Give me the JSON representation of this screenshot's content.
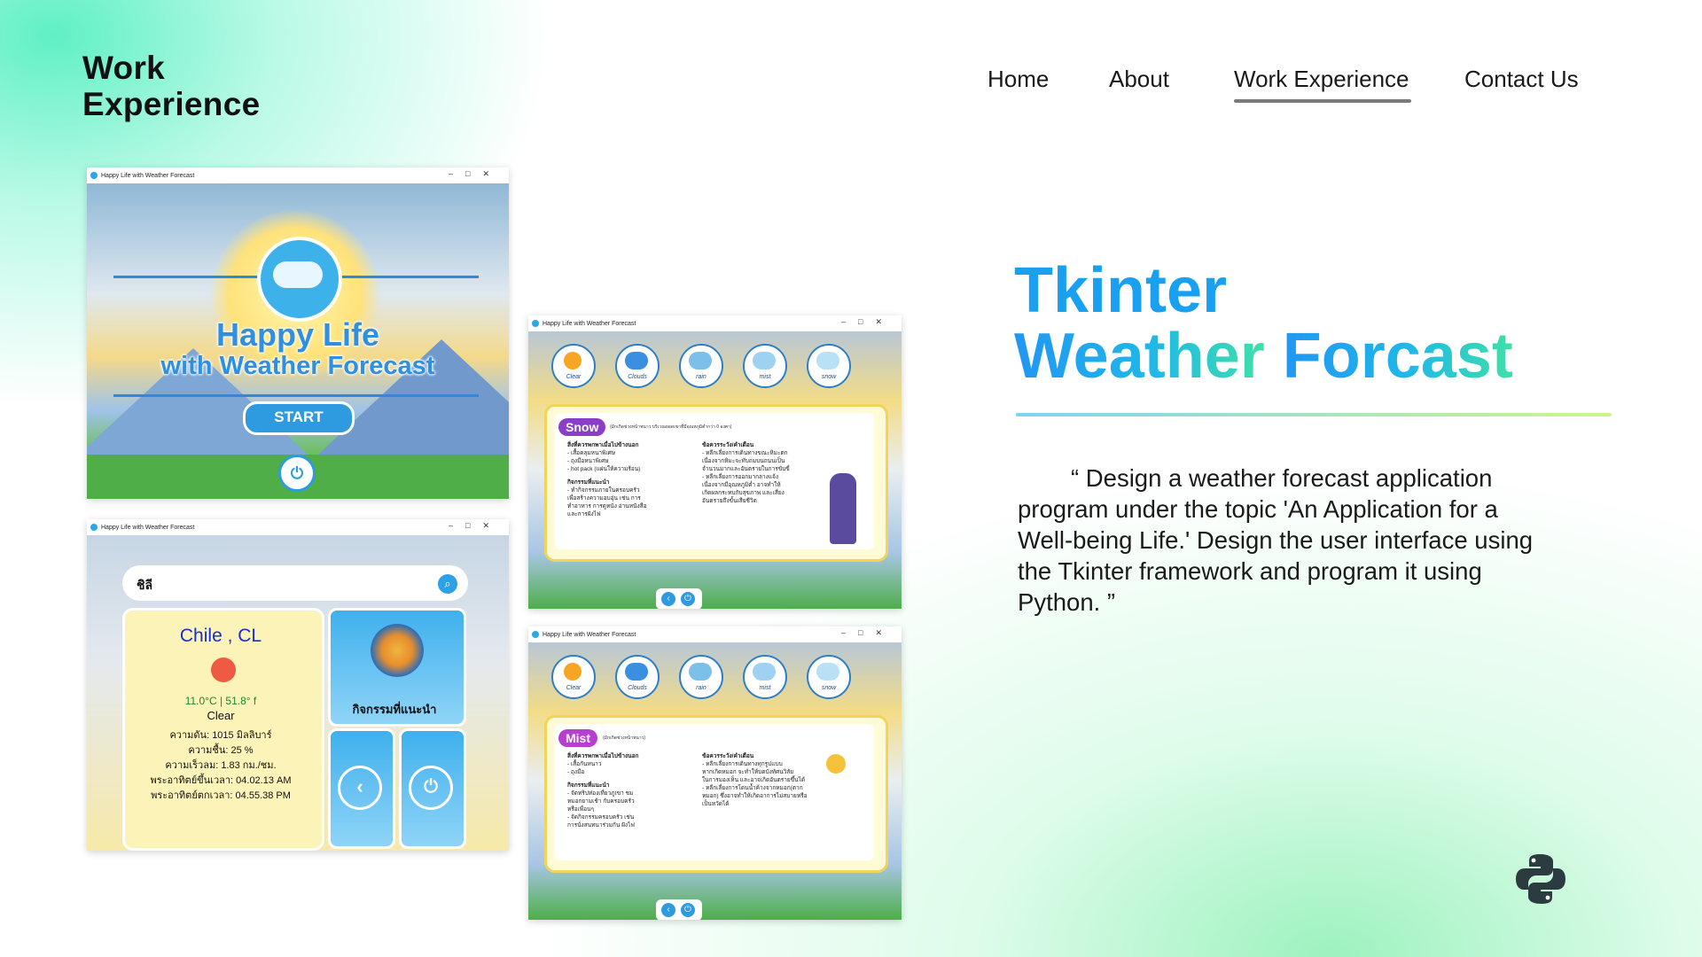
{
  "header": {
    "page_title_line1": "Work",
    "page_title_line2": "Experience",
    "nav": [
      {
        "label": "Home"
      },
      {
        "label": "About"
      },
      {
        "label": "Work Experience",
        "active": true
      },
      {
        "label": "Contact Us"
      }
    ]
  },
  "window_title": "Happy Life with Weather Forecast",
  "screen_start": {
    "title_line1": "Happy Life",
    "title_line2": "with Weather Forecast",
    "start_button": "START"
  },
  "screen_weather": {
    "search_value": "ชิลี",
    "city": "Chile , CL",
    "temperature": "11.0°C | 51.8° f",
    "condition": "Clear",
    "pressure": "ความดัน: 1015  มิลลิบาร์",
    "humidity": "ความชื้น: 25 %",
    "wind": "ความเร็วลม: 1.83  กม./ชม.",
    "sunrise": "พระอาทิตย์ขึ้นเวลา: 04.02.13 AM",
    "sunset": "พระอาทิตย์ตกเวลา: 04.55.38 PM",
    "activity_label": "กิจกรรมที่แนะนำ"
  },
  "weather_icons": [
    {
      "label": "Clear",
      "color": "#f6a623"
    },
    {
      "label": "Clouds",
      "color": "#3a8fe0"
    },
    {
      "label": "rain",
      "color": "#7cc0ea"
    },
    {
      "label": "mist",
      "color": "#9fd2f0"
    },
    {
      "label": "snow",
      "color": "#b9e1f5"
    }
  ],
  "screen_snow": {
    "tag": "Snow",
    "tag_color": "#8a3ec8",
    "note": "(มักเกิดช่วงหน้าหนาว บริเวณยอดเขาที่มีอุณหภูมิต่ำกว่า 0 องศา)",
    "left_head1": "สิ่งที่ควรพกพาเมื่อไปข้างนอก",
    "left_items1": [
      "- เสื้อคลุมหนาพิเศษ",
      "- ถุงมือหนาพิเศษ",
      "- hot pack (แผ่นให้ความร้อน)"
    ],
    "left_head2": "กิจกรรมที่แนะนำ",
    "left_items2": [
      "- ทำกิจกรรมภายในครอบครัว",
      "เพื่อสร้างความอบอุ่น เช่น การ",
      "ทำอาหาร การดูหนัง อ่านหนังสือ",
      "และการฝังไฟ"
    ],
    "right_head": "ข้อควรระวัง/คำเตือน",
    "right_items": [
      "- หลีกเลี่ยงการเดินทางขณะหิมะตก",
      "เนื่องจากหิมะจะทับถมบนถนนเป็น",
      "จำนวนมากและอันตรายในการขับขี่",
      "- หลีกเลี่ยงการออกมากลางแจ้ง",
      "เนื่องจากมีอุณหภูมิต่ำ อาจทำให้",
      "เกิดผลกระทบกับสุขภาพ และเสี่ยง",
      "อันตรายถึงขั้นเสียชีวิต"
    ]
  },
  "screen_mist": {
    "tag": "Mist",
    "tag_color": "#b63fd0",
    "note": "(มักเกิดช่วงหน้าหนาว)",
    "left_head1": "สิ่งที่ควรพกพาเมื่อไปข้างนอก",
    "left_items1": [
      "- เสื้อกันหนาว",
      "- ถุงมือ"
    ],
    "left_head2": "กิจกรรมที่แนะนำ",
    "left_items2": [
      "- จัดทริปท่องเที่ยวภูเขา ชม",
      "หมอกยามเช้า กับครอบครัว",
      "หรือเพื่อนๆ",
      "- จัดกิจกรรมครอบครัว เช่น",
      "การนั่งสนทนาร่วมกัน ฝังไฟ"
    ],
    "right_head": "ข้อควรระวัง/คำเตือน",
    "right_items": [
      "- หลีกเลี่ยงการเดินทางทุกรูปแบบ",
      "หากเกิดหมอก จะทำให้บดบังทัศนวิสัย",
      "ในการมองเห็น และอาจเกิดอันตรายขึ้นได้",
      "- หลีกเลี่ยงการโดนน้ำค้างจากหมอก(ตาก",
      "หมอก) ซึ่งอาจทำให้เกิดอาการไม่สบายหรือ",
      "เป็นหวัดได้"
    ]
  },
  "headline": {
    "line1": "Tkinter",
    "line2_part1": "Weather",
    "line2_part2": "Forcast"
  },
  "quote": "“ Design a weather forecast application program under the topic 'An Application for a Well-being Life.' Design the user interface using the Tkinter framework and program it using Python. ”"
}
